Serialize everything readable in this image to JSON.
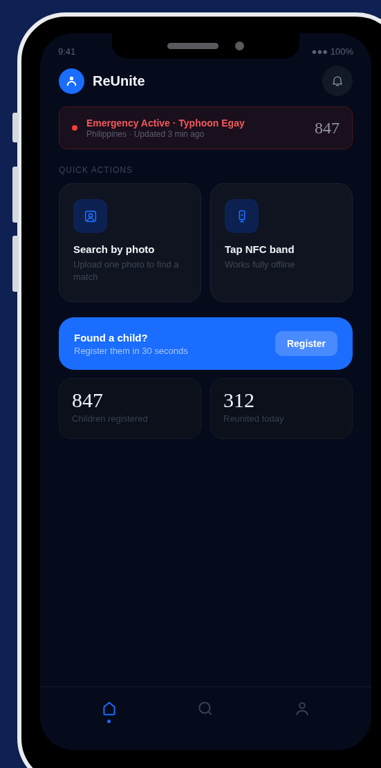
{
  "status_bar": {
    "time": "9:41",
    "battery": "●●● 100%"
  },
  "header": {
    "app_name": "ReUnite"
  },
  "alert": {
    "title": "Emergency Active · Typhoon Egay",
    "subtitle": "Philippines · Updated 3 min ago",
    "count": "847"
  },
  "quick_actions": {
    "label": "QUICK ACTIONS",
    "items": [
      {
        "kind": "photo",
        "title": "Search by photo",
        "description": "Upload one photo to find a match"
      },
      {
        "kind": "nfc",
        "title": "Tap NFC band",
        "description": "Works fully offline"
      }
    ]
  },
  "banner": {
    "title": "Found a child?",
    "subtitle": "Register them in 30 seconds",
    "button": "Register"
  },
  "stats": [
    {
      "value": "847",
      "label": "Children registered"
    },
    {
      "value": "312",
      "label": "Reunited today"
    }
  ],
  "nav": [
    {
      "kind": "home",
      "selected": true
    },
    {
      "kind": "search",
      "selected": false
    },
    {
      "kind": "profile",
      "selected": false
    }
  ]
}
